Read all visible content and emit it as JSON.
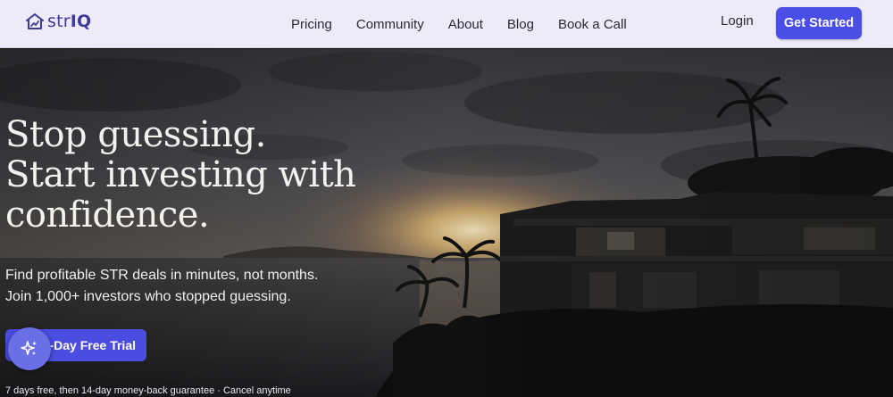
{
  "brand": {
    "name_prefix": "str",
    "name_suffix": "IQ",
    "accent": "#4b4ee6",
    "logo_color": "#3d3a98"
  },
  "nav": {
    "links": [
      "Pricing",
      "Community",
      "About",
      "Blog",
      "Book a Call"
    ],
    "login_label": "Login",
    "cta_label": "Get Started"
  },
  "hero": {
    "headline_lines": [
      "Stop guessing.",
      "Start investing with",
      "confidence."
    ],
    "subheadline_lines": [
      "Find profitable STR deals in minutes, not months.",
      "Join 1,000+ investors who stopped guessing."
    ],
    "trial_button_label": "-Day Free Trial",
    "fine_print": "7 days free, then 14-day money-back guarantee · Cancel anytime",
    "chat_fab_icon": "sparkles-icon"
  }
}
